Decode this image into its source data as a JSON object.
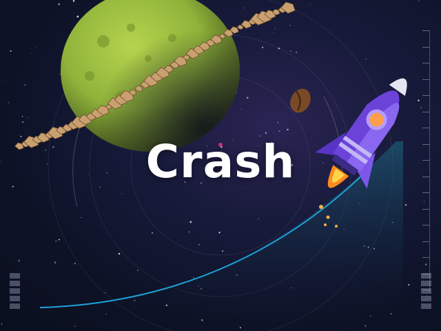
{
  "game": {
    "title": "Crash"
  },
  "colors": {
    "background": "#0a0f1e",
    "curve": "#1ea4d8",
    "planet": "#8fb33a",
    "rocket_body": "#6b43d8",
    "rocket_nose": "#e6e6f2",
    "flame": "#ff8a1f"
  },
  "icons": {
    "rocket": "rocket-icon",
    "planet": "planet-icon",
    "asteroid": "asteroid-icon"
  }
}
